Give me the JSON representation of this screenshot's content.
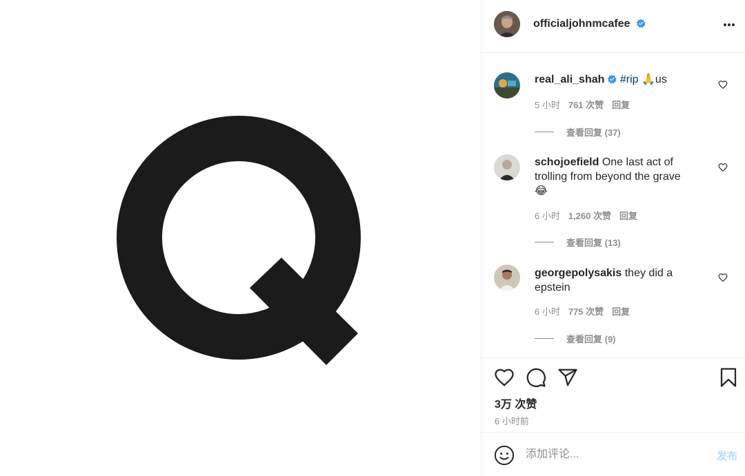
{
  "post": {
    "username": "officialjohnmcafee",
    "likes": "3万 次赞",
    "time_ago": "6 小时前"
  },
  "colors": {
    "verified": "#3897f0",
    "link": "#00376b",
    "post_button": "#b2dffc",
    "meta": "#8e8e8e"
  },
  "comments": [
    {
      "username": "real_ali_shah",
      "verified": true,
      "hashtag": "#rip",
      "emoji": "🙏",
      "text_suffix": "us",
      "time": "5 小时",
      "likes": "761 次赞",
      "reply": "回复",
      "view_replies": "查看回复 (37)"
    },
    {
      "username": "schojoefield",
      "text": "One last act of trolling from beyond the grave",
      "emoji": "😂",
      "time": "6 小时",
      "likes": "1,260 次赞",
      "reply": "回复",
      "view_replies": "查看回复 (13)"
    },
    {
      "username": "georgepolysakis",
      "text": "they did a epstein",
      "time": "6 小时",
      "likes": "775 次赞",
      "reply": "回复",
      "view_replies": "查看回复 (9)"
    }
  ],
  "comment_box": {
    "placeholder": "添加评论...",
    "post_label": "发布"
  },
  "icons": {
    "more": "more-options-icon",
    "like": "heart-icon",
    "comment": "comment-icon",
    "share": "share-icon",
    "save": "bookmark-icon",
    "emoji": "emoji-icon"
  }
}
